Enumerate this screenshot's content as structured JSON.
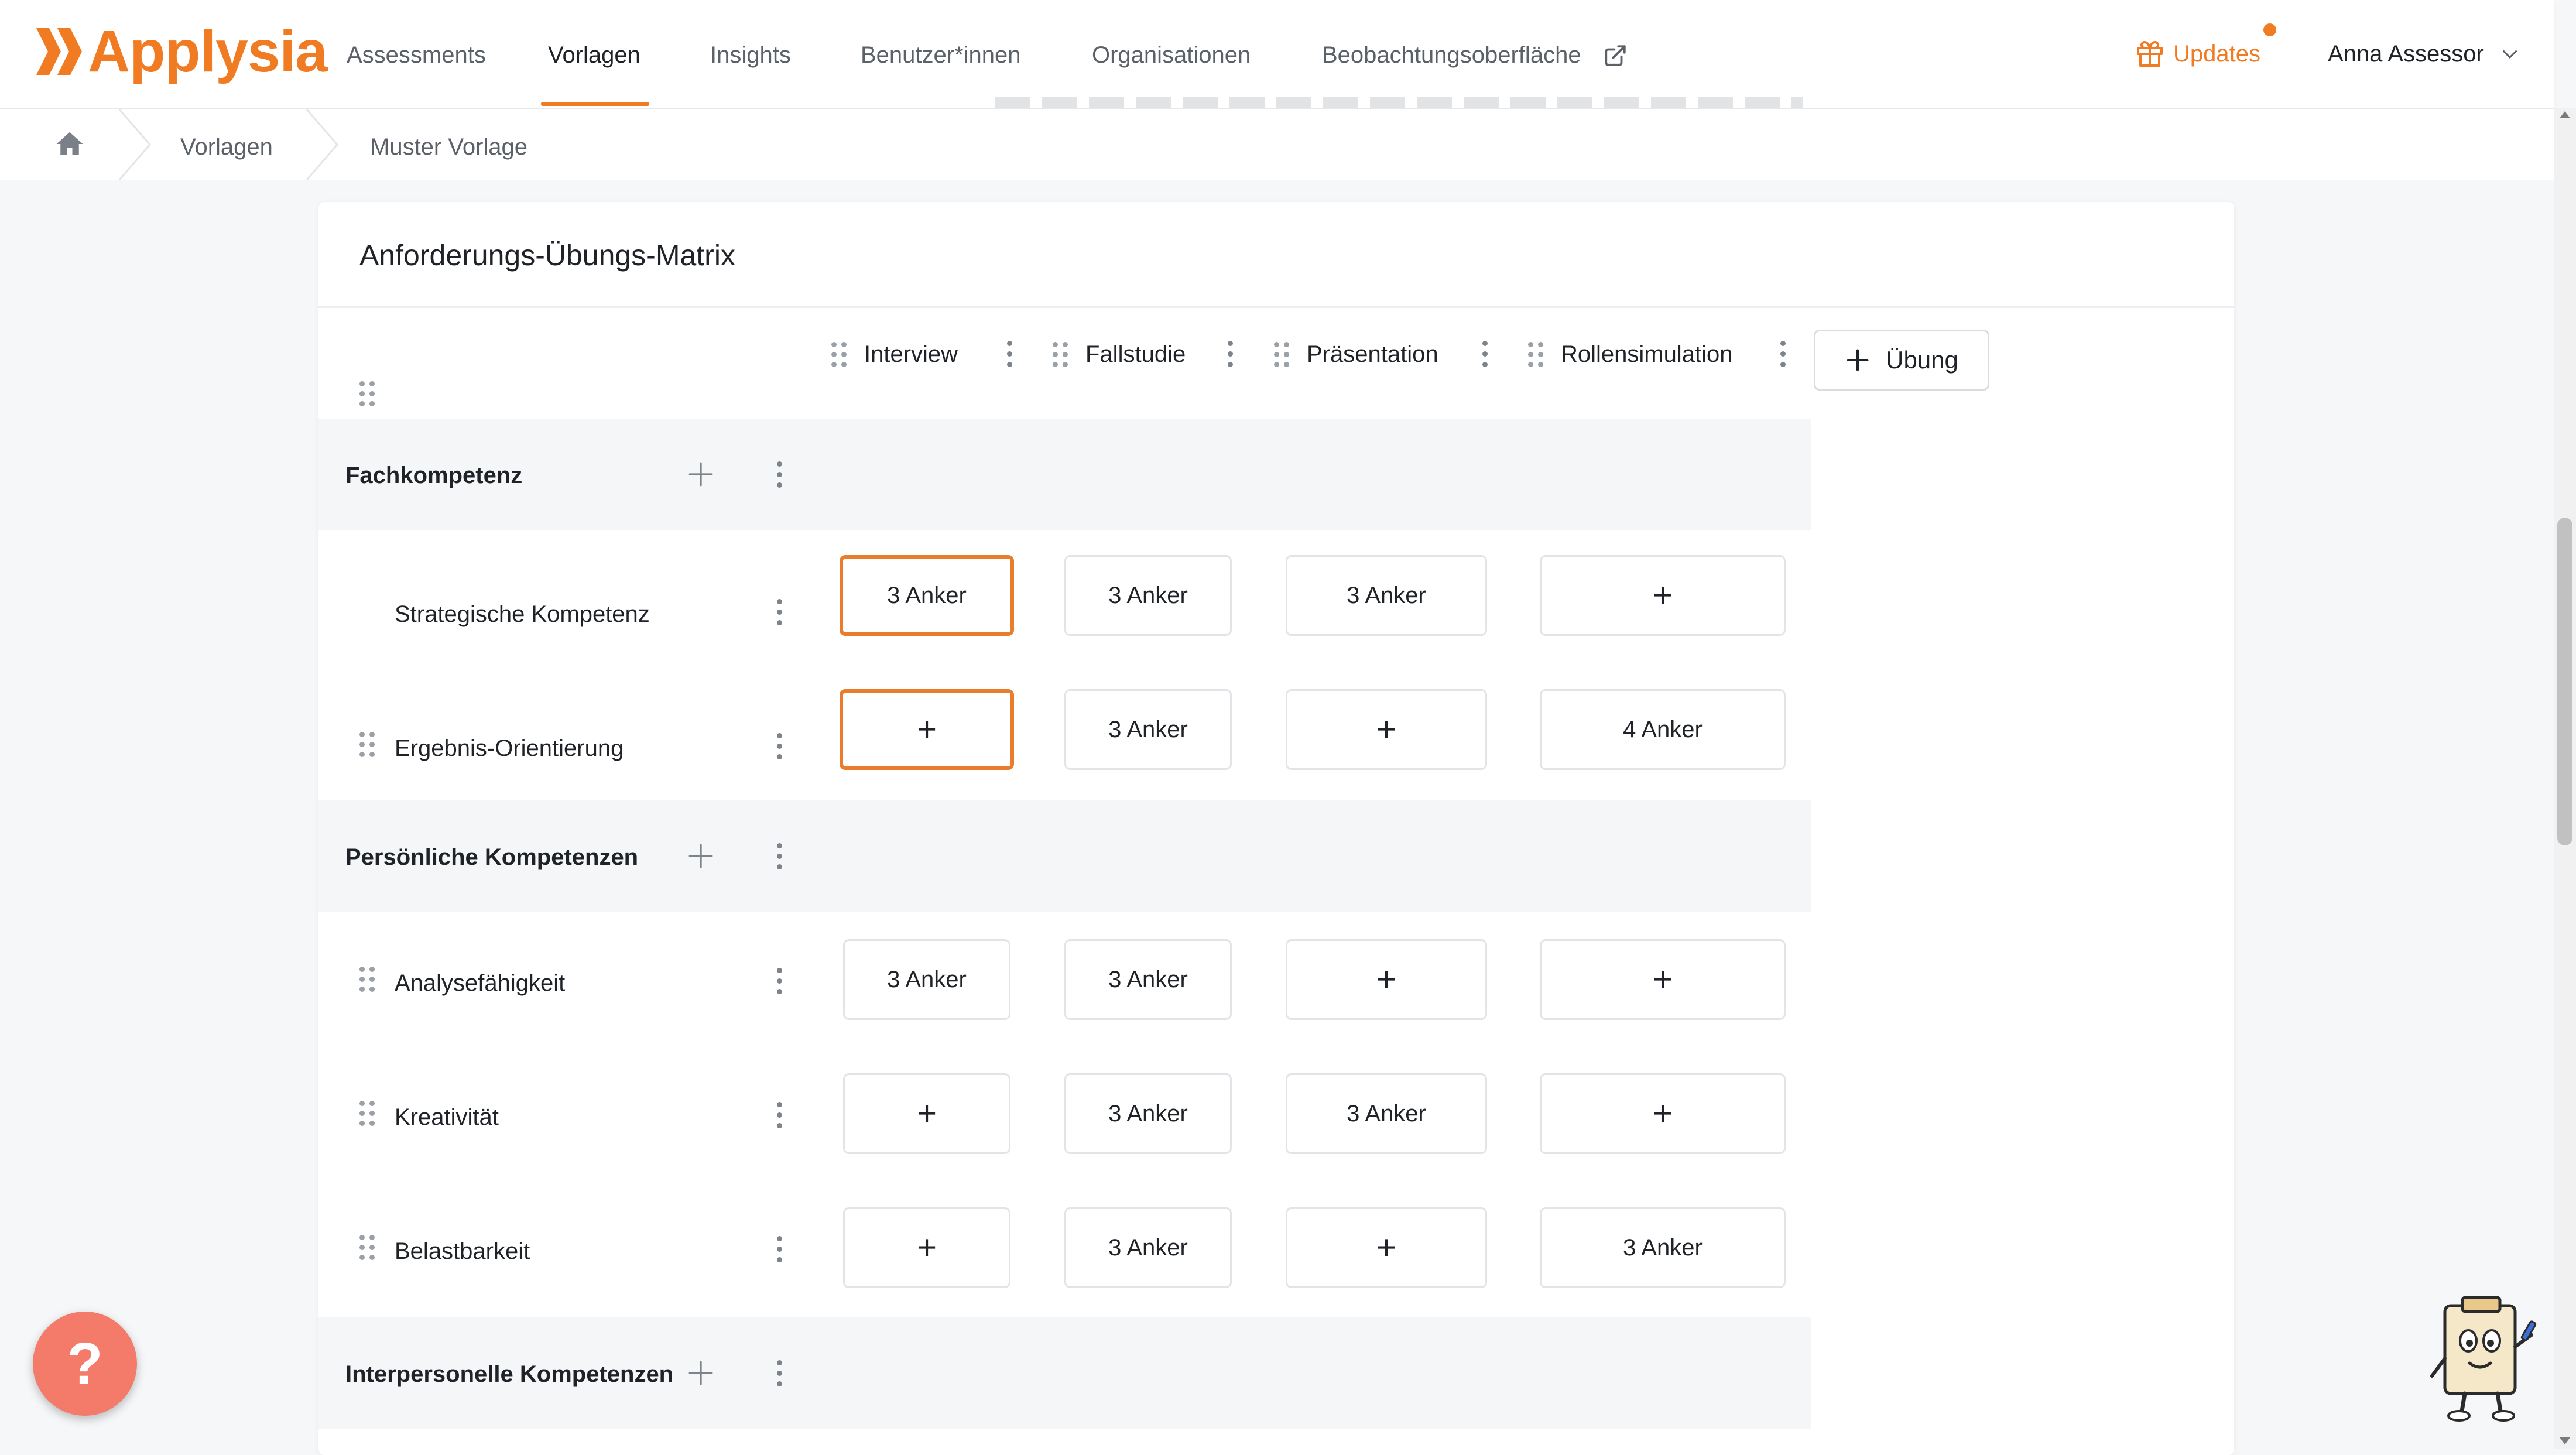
{
  "app": {
    "brand": "Applysia",
    "accent_color": "#f07b22"
  },
  "nav": {
    "items": [
      {
        "label": "Assessments",
        "active": false
      },
      {
        "label": "Vorlagen",
        "active": true
      },
      {
        "label": "Insights",
        "active": false
      },
      {
        "label": "Benutzer*innen",
        "active": false
      },
      {
        "label": "Organisationen",
        "active": false
      },
      {
        "label": "Beobachtungsoberfläche",
        "active": false,
        "icon": "external-link-icon"
      }
    ],
    "updates_label": "Updates",
    "user_name": "Anna Assessor"
  },
  "breadcrumb": {
    "items": [
      "Vorlagen",
      "Muster Vorlage"
    ]
  },
  "matrix": {
    "title": "Anforderungs-Übungs-Matrix",
    "add_exercise_label": "Übung",
    "exercises": [
      "Interview",
      "Fallstudie",
      "Präsentation",
      "Rollensimulation"
    ],
    "groups": [
      {
        "name": "Fachkompetenz",
        "competences": [
          {
            "name": "Strategische Kompetenz",
            "cells": [
              "3 Anker",
              "3 Anker",
              "3 Anker",
              "+"
            ]
          },
          {
            "name": "Ergebnis-Orientierung",
            "cells": [
              "+",
              "3 Anker",
              "+",
              "4 Anker"
            ]
          }
        ]
      },
      {
        "name": "Persönliche Kompetenzen",
        "competences": [
          {
            "name": "Analysefähigkeit",
            "cells": [
              "3 Anker",
              "3 Anker",
              "+",
              "+"
            ]
          },
          {
            "name": "Kreativität",
            "cells": [
              "+",
              "3 Anker",
              "3 Anker",
              "+"
            ]
          },
          {
            "name": "Belastbarkeit",
            "cells": [
              "+",
              "3 Anker",
              "+",
              "3 Anker"
            ]
          }
        ]
      },
      {
        "name": "Interpersonelle Kompetenzen",
        "competences": []
      }
    ]
  },
  "help": {
    "label": "?"
  }
}
